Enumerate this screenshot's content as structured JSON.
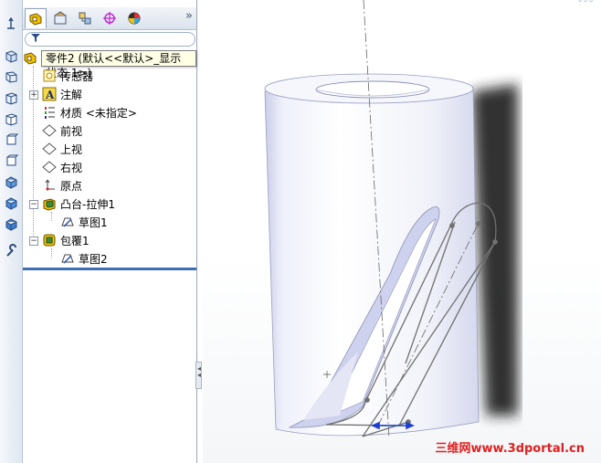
{
  "feature_tree": {
    "part": {
      "label": "零件2 (默认<<默认>_显示状态 1>)"
    },
    "items": [
      {
        "label": "传感器",
        "icon": "sensor-icon"
      },
      {
        "label": "注解",
        "icon": "annotation-icon"
      },
      {
        "label": "材质 <未指定>",
        "icon": "material-icon"
      },
      {
        "label": "前视",
        "icon": "plane-icon"
      },
      {
        "label": "上视",
        "icon": "plane-icon"
      },
      {
        "label": "右视",
        "icon": "plane-icon"
      },
      {
        "label": "原点",
        "icon": "origin-icon"
      },
      {
        "label": "凸台-拉伸1",
        "icon": "boss-extrude-icon"
      },
      {
        "label": "草图1",
        "icon": "sketch-icon"
      },
      {
        "label": "包覆1",
        "icon": "wrap-icon"
      },
      {
        "label": "草图2",
        "icon": "sketch-icon"
      }
    ]
  },
  "tabs": [
    "featuremanager-tab",
    "propertymanager-tab",
    "configurationmanager-tab",
    "dimxpert-tab",
    "display-manager-tab"
  ],
  "tab_overflow_label": "»",
  "filter_icon": "filter-icon",
  "watermark": "三维网www.3dportal.cn",
  "colors": {
    "tree_selection_bar": "#3c6fb4",
    "watermark": "#e02020",
    "dimension_arrow": "#1a3fd0"
  }
}
